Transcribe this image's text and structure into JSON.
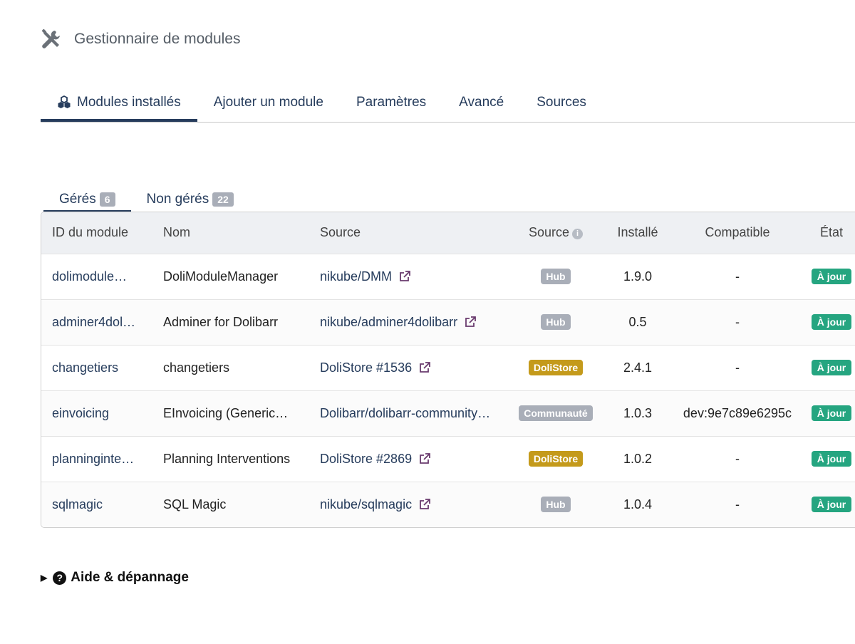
{
  "header": {
    "title": "Gestionnaire de modules",
    "icon": "tools-icon"
  },
  "main_tabs": [
    {
      "label": "Modules installés",
      "active": true,
      "icon": "cubes-icon"
    },
    {
      "label": "Ajouter un module",
      "active": false
    },
    {
      "label": "Paramètres",
      "active": false
    },
    {
      "label": "Avancé",
      "active": false
    },
    {
      "label": "Sources",
      "active": false
    }
  ],
  "sub_tabs": [
    {
      "label": "Gérés",
      "count": "6",
      "active": true
    },
    {
      "label": "Non gérés",
      "count": "22",
      "active": false
    }
  ],
  "table": {
    "columns": [
      "ID du module",
      "Nom",
      "Source",
      "Source",
      "Installé",
      "Compatible",
      "État"
    ],
    "rows": [
      {
        "id": "dolimodule…",
        "name": "DoliModuleManager",
        "source": "nikube/DMM",
        "external": true,
        "source_type": "Hub",
        "installed": "1.9.0",
        "compatible": "-",
        "state": "À jour"
      },
      {
        "id": "adminer4dol…",
        "name": "Adminer for Dolibarr",
        "source": "nikube/adminer4dolibarr",
        "external": true,
        "source_type": "Hub",
        "installed": "0.5",
        "compatible": "-",
        "state": "À jour"
      },
      {
        "id": "changetiers",
        "name": "changetiers",
        "source": "DoliStore #1536",
        "external": true,
        "source_type": "DoliStore",
        "installed": "2.4.1",
        "compatible": "-",
        "state": "À jour"
      },
      {
        "id": "einvoicing",
        "name": "EInvoicing (Generic…",
        "source": "Dolibarr/dolibarr-community…",
        "external": false,
        "source_type": "Communauté",
        "installed": "1.0.3",
        "compatible": "dev:9e7c89e6295c",
        "state": "À jour"
      },
      {
        "id": "planninginte…",
        "name": "Planning Interventions",
        "source": "DoliStore #2869",
        "external": true,
        "source_type": "DoliStore",
        "installed": "1.0.2",
        "compatible": "-",
        "state": "À jour"
      },
      {
        "id": "sqlmagic",
        "name": "SQL Magic",
        "source": "nikube/sqlmagic",
        "external": true,
        "source_type": "Hub",
        "installed": "1.0.4",
        "compatible": "-",
        "state": "À jour"
      }
    ]
  },
  "help": {
    "label": "Aide & dépannage"
  },
  "colors": {
    "primary": "#263c5c",
    "badge_gray": "#a9aeb8",
    "badge_dolistore": "#c49a1b",
    "badge_state": "#25a580"
  }
}
